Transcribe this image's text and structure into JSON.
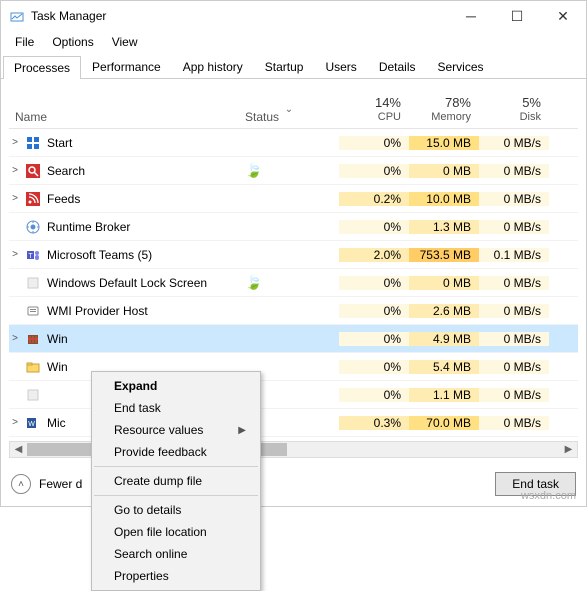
{
  "window": {
    "title": "Task Manager"
  },
  "menus": {
    "file": "File",
    "options": "Options",
    "view": "View"
  },
  "tabs": [
    "Processes",
    "Performance",
    "App history",
    "Startup",
    "Users",
    "Details",
    "Services"
  ],
  "active_tab": 0,
  "columns": {
    "name": "Name",
    "status": "Status",
    "cpu_pct": "14%",
    "cpu": "CPU",
    "mem_pct": "78%",
    "mem": "Memory",
    "disk_pct": "5%",
    "disk": "Disk"
  },
  "rows": [
    {
      "expand": ">",
      "icon": "start",
      "name": "Start",
      "status": "",
      "cpu": "0%",
      "cpu_h": 0,
      "mem": "15.0 MB",
      "mem_h": 2,
      "disk": "0 MB/s",
      "disk_h": 0
    },
    {
      "expand": ">",
      "icon": "search",
      "name": "Search",
      "status": "leaf",
      "cpu": "0%",
      "cpu_h": 0,
      "mem": "0 MB",
      "mem_h": 1,
      "disk": "0 MB/s",
      "disk_h": 0
    },
    {
      "expand": ">",
      "icon": "feeds",
      "name": "Feeds",
      "status": "",
      "cpu": "0.2%",
      "cpu_h": 1,
      "mem": "10.0 MB",
      "mem_h": 2,
      "disk": "0 MB/s",
      "disk_h": 0
    },
    {
      "expand": "",
      "icon": "runtime",
      "name": "Runtime Broker",
      "status": "",
      "cpu": "0%",
      "cpu_h": 0,
      "mem": "1.3 MB",
      "mem_h": 1,
      "disk": "0 MB/s",
      "disk_h": 0
    },
    {
      "expand": ">",
      "icon": "teams",
      "name": "Microsoft Teams (5)",
      "status": "",
      "cpu": "2.0%",
      "cpu_h": 1,
      "mem": "753.5 MB",
      "mem_h": 3,
      "disk": "0.1 MB/s",
      "disk_h": 0
    },
    {
      "expand": "",
      "icon": "blank",
      "name": "Windows Default Lock Screen",
      "status": "leaf",
      "cpu": "0%",
      "cpu_h": 0,
      "mem": "0 MB",
      "mem_h": 1,
      "disk": "0 MB/s",
      "disk_h": 0
    },
    {
      "expand": "",
      "icon": "wmi",
      "name": "WMI Provider Host",
      "status": "",
      "cpu": "0%",
      "cpu_h": 0,
      "mem": "2.6 MB",
      "mem_h": 1,
      "disk": "0 MB/s",
      "disk_h": 0
    },
    {
      "expand": ">",
      "icon": "winrar",
      "name": "Win",
      "status": "",
      "cpu": "0%",
      "cpu_h": 0,
      "mem": "4.9 MB",
      "mem_h": 1,
      "disk": "0 MB/s",
      "disk_h": 0,
      "selected": true
    },
    {
      "expand": "",
      "icon": "explorer",
      "name": "Win",
      "status": "",
      "cpu": "0%",
      "cpu_h": 0,
      "mem": "5.4 MB",
      "mem_h": 1,
      "disk": "0 MB/s",
      "disk_h": 0
    },
    {
      "expand": "",
      "icon": "blank",
      "name": "",
      "status": "",
      "cpu": "0%",
      "cpu_h": 0,
      "mem": "1.1 MB",
      "mem_h": 1,
      "disk": "0 MB/s",
      "disk_h": 0
    },
    {
      "expand": ">",
      "icon": "word",
      "name": "Mic",
      "status": "",
      "cpu": "0.3%",
      "cpu_h": 1,
      "mem": "70.0 MB",
      "mem_h": 2,
      "disk": "0 MB/s",
      "disk_h": 0
    }
  ],
  "footer": {
    "fewer": "Fewer d",
    "end_task": "End task"
  },
  "context_menu": {
    "expand": "Expand",
    "end_task": "End task",
    "resource_values": "Resource values",
    "provide_feedback": "Provide feedback",
    "create_dump": "Create dump file",
    "go_details": "Go to details",
    "open_file": "Open file location",
    "search_online": "Search online",
    "properties": "Properties"
  },
  "watermark": "wsxdn.com"
}
